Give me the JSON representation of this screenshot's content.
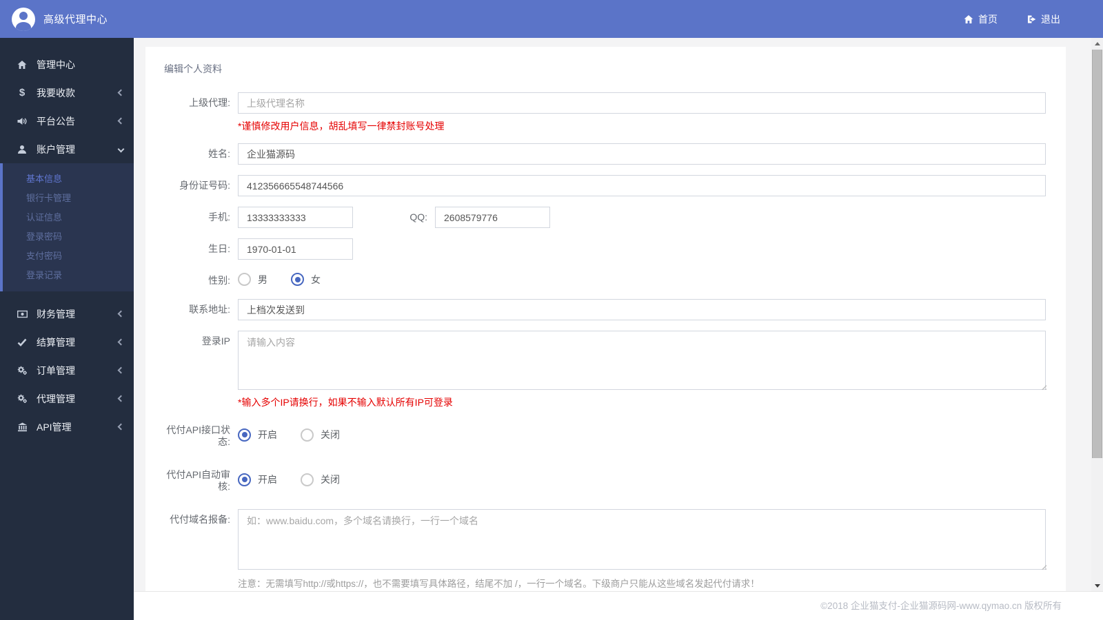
{
  "navbar": {
    "brand": "高级代理中心",
    "home_label": "首页",
    "logout_label": "退出"
  },
  "sidebar": {
    "items": [
      {
        "label": "管理中心",
        "icon": "home-icon"
      },
      {
        "label": "我要收款",
        "icon": "dollar-icon"
      },
      {
        "label": "平台公告",
        "icon": "volume-icon"
      },
      {
        "label": "账户管理",
        "icon": "user-icon"
      },
      {
        "label": "财务管理",
        "icon": "money-icon"
      },
      {
        "label": "结算管理",
        "icon": "check-icon"
      },
      {
        "label": "订单管理",
        "icon": "cogs-icon"
      },
      {
        "label": "代理管理",
        "icon": "cogs-icon"
      },
      {
        "label": "API管理",
        "icon": "bank-icon"
      }
    ],
    "submenu": {
      "items": [
        "基本信息",
        "银行卡管理",
        "认证信息",
        "登录密码",
        "支付密码",
        "登录记录"
      ],
      "active": "基本信息"
    }
  },
  "form": {
    "title": "编辑个人资料",
    "superior": {
      "label": "上级代理:",
      "placeholder": "上级代理名称",
      "warning": "*谨慎修改用户信息，胡乱填写一律禁封账号处理"
    },
    "name": {
      "label": "姓名:",
      "value": "企业猫源码"
    },
    "id_number": {
      "label": "身份证号码:",
      "value": "412356665548744566"
    },
    "mobile": {
      "label": "手机:",
      "value": "13333333333"
    },
    "qq": {
      "label": "QQ:",
      "value": "2608579776"
    },
    "birthday": {
      "label": "生日:",
      "value": "1970-01-01"
    },
    "gender": {
      "label": "性别:",
      "options": [
        "男",
        "女"
      ],
      "selected": "女"
    },
    "address": {
      "label": "联系地址:",
      "value": "上档次发送到"
    },
    "login_ip": {
      "label": "登录IP",
      "placeholder": "请输入内容",
      "warning": "*输入多个IP请换行，如果不输入默认所有IP可登录"
    },
    "api_status": {
      "label": "代付API接口状态:",
      "options": [
        "开启",
        "关闭"
      ],
      "selected": "开启"
    },
    "api_auto_audit": {
      "label": "代付API自动审核:",
      "options": [
        "开启",
        "关闭"
      ],
      "selected": "开启"
    },
    "payout_domains": {
      "label": "代付域名报备:",
      "placeholder": "如：www.baidu.com，多个域名请换行，一行一个域名",
      "note": "注意：无需填写http://或https://，也不需要填写具体路径，结尾不加 /，一行一个域名。下级商户只能从这些域名发起代付请求！"
    }
  },
  "footer": {
    "copyright": "©2018 企业猫支付-企业猫源码网-www.qymao.cn 版权所有"
  },
  "colors": {
    "accent_blue": "#5b74c8",
    "sidebar_dark": "#232d3f",
    "submenu_bg": "#2a3550",
    "radio_blue": "#4767c0",
    "warning_red": "#e50000",
    "page_bg": "#f4f4f5"
  }
}
